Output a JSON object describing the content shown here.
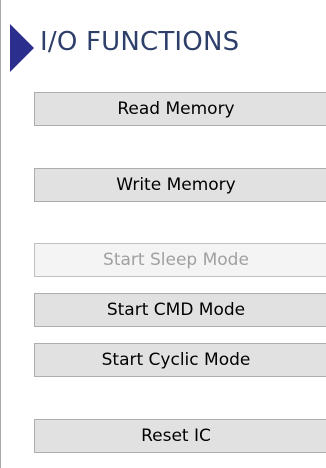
{
  "header": {
    "title": "I/O FUNCTIONS",
    "marker_color": "#2b2e8c",
    "title_color": "#2e3f6a"
  },
  "buttons": [
    {
      "label": "Read Memory",
      "enabled": true
    },
    {
      "label": "Write Memory",
      "enabled": true
    },
    {
      "label": "Start Sleep Mode",
      "enabled": false
    },
    {
      "label": "Start CMD Mode",
      "enabled": true
    },
    {
      "label": "Start Cyclic Mode",
      "enabled": true
    },
    {
      "label": "Reset IC",
      "enabled": true
    }
  ]
}
